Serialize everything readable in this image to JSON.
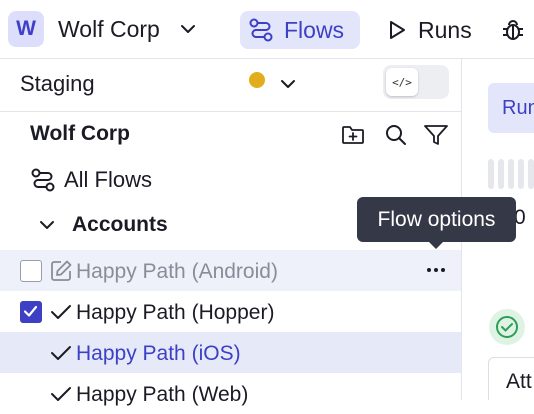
{
  "workspace": {
    "badge": "W",
    "name": "Wolf Corp"
  },
  "nav": {
    "tabs": [
      {
        "label": "Flows",
        "active": true,
        "icon": "flows-icon"
      },
      {
        "label": "Runs",
        "active": false,
        "icon": "play-icon"
      },
      {
        "label": "",
        "active": false,
        "icon": "bug-icon"
      }
    ]
  },
  "environment": {
    "name": "Staging",
    "status_color": "#e2ad1c",
    "code_toggle": "</>"
  },
  "tree": {
    "org_title": "Wolf Corp",
    "all_flows_label": "All Flows",
    "folder": {
      "name": "Accounts",
      "expanded": true,
      "flows": [
        {
          "label": "Happy Path (Android)",
          "checked": false,
          "hovered": true,
          "lead_icon": "edit-icon"
        },
        {
          "label": "Happy Path (Hopper)",
          "checked": true,
          "selected": false,
          "lead_icon": "checkmark-icon"
        },
        {
          "label": "Happy Path (iOS)",
          "checked": false,
          "selected": true,
          "lead_icon": "checkmark-icon"
        },
        {
          "label": "Happy Path (Web)",
          "checked": false,
          "selected": false,
          "lead_icon": "checkmark-icon"
        }
      ]
    }
  },
  "tooltip": {
    "text": "Flow options"
  },
  "right_panel": {
    "button_text": "Run",
    "count_text": "0",
    "box_text": "Att"
  },
  "colors": {
    "accent": "#3d3fc4",
    "accent_soft": "#e3e6fb",
    "tooltip_bg": "#353846",
    "status_ok": "#2e9e55"
  }
}
